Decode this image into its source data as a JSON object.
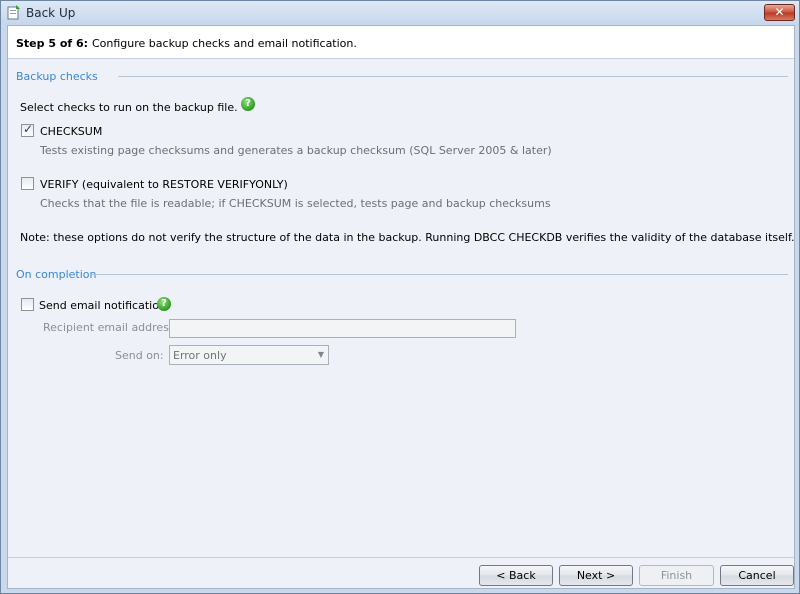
{
  "window": {
    "title": "Back Up",
    "close_label": "✕"
  },
  "header": {
    "step": "Step 5 of 6:",
    "description": "Configure backup checks and email notification."
  },
  "backup_checks": {
    "section_title": "Backup checks",
    "intro": "Select checks to run on the backup file.",
    "help_glyph": "?",
    "checksum": {
      "label": "CHECKSUM",
      "checked": true,
      "check_glyph": "✓",
      "description": "Tests existing page checksums and generates a backup checksum (SQL Server 2005 & later)"
    },
    "verify": {
      "label": "VERIFY (equivalent to RESTORE VERIFYONLY)",
      "checked": false,
      "description": "Checks that the file is readable; if CHECKSUM is selected, tests page and backup checksums"
    },
    "note": "Note: these options do not verify the structure of the data in the backup. Running DBCC CHECKDB verifies the validity of the database itself."
  },
  "on_completion": {
    "section_title": "On completion",
    "send_email": {
      "label": "Send email notification",
      "checked": false
    },
    "help_glyph": "?",
    "recipient_label": "Recipient email address:",
    "recipient_value": "",
    "send_on_label": "Send on:",
    "send_on_value": "Error only"
  },
  "footer": {
    "back": "< Back",
    "next": "Next >",
    "finish": "Finish",
    "cancel": "Cancel"
  },
  "colors": {
    "section_title": "#3a86d8",
    "help_icon": "#2e9a23",
    "close_button": "#c8503a"
  }
}
